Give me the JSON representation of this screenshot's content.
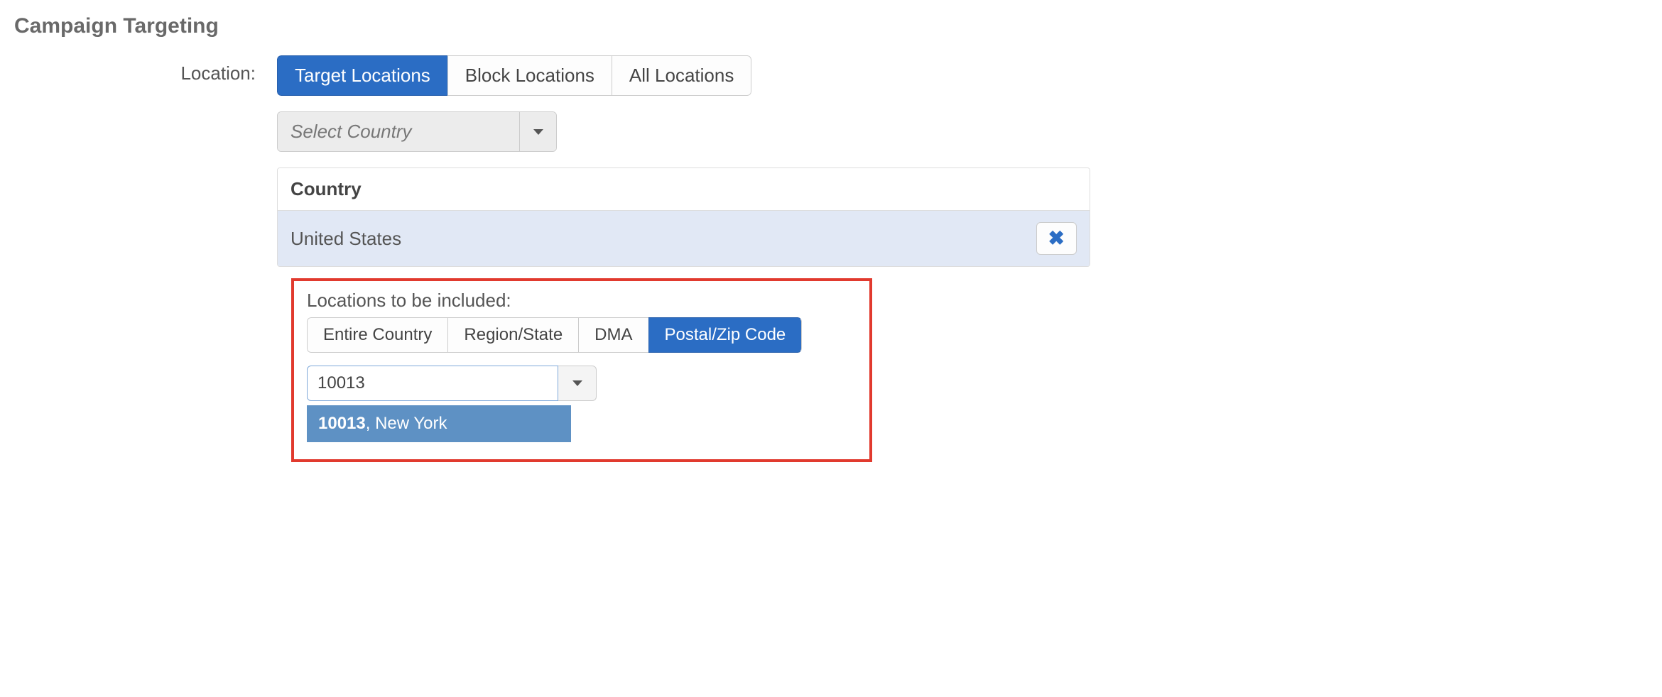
{
  "section": {
    "title": "Campaign Targeting"
  },
  "location": {
    "label": "Location:",
    "tabs": [
      {
        "label": "Target Locations",
        "active": true
      },
      {
        "label": "Block Locations",
        "active": false
      },
      {
        "label": "All Locations",
        "active": false
      }
    ],
    "country_select_placeholder": "Select Country",
    "country_panel": {
      "header": "Country",
      "selected": "United States"
    }
  },
  "include": {
    "label": "Locations to be included:",
    "scopes": [
      {
        "label": "Entire Country",
        "active": false
      },
      {
        "label": "Region/State",
        "active": false
      },
      {
        "label": "DMA",
        "active": false
      },
      {
        "label": "Postal/Zip Code",
        "active": true
      }
    ],
    "zip_input_value": "10013",
    "autocomplete": {
      "match": "10013",
      "rest": ", New York"
    }
  }
}
